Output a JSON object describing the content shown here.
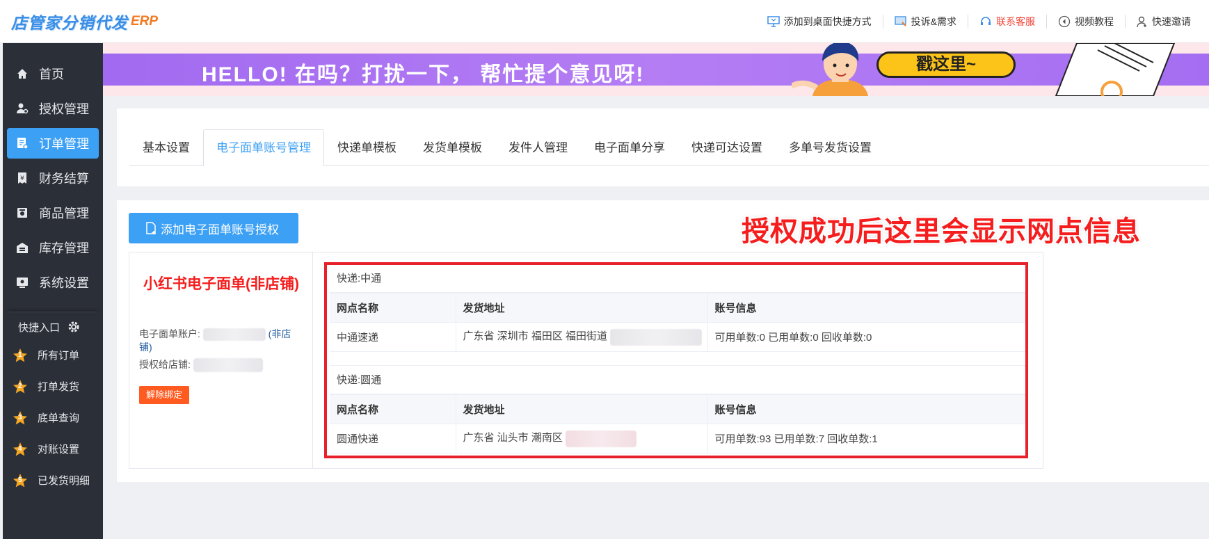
{
  "app": {
    "logo_text": "店管家分销代发",
    "logo_suffix": "ERP"
  },
  "topnav": [
    {
      "label": "添加到桌面快捷方式",
      "icon": "desktop-icon"
    },
    {
      "label": "投诉&需求",
      "icon": "feedback-icon"
    },
    {
      "label": "联系客服",
      "icon": "headset-icon",
      "color": "#f04134"
    },
    {
      "label": "视频教程",
      "icon": "play-icon"
    },
    {
      "label": "快速邀请",
      "icon": "user-add-icon"
    }
  ],
  "sidebar": {
    "items": [
      {
        "label": "首页",
        "icon": "home-icon"
      },
      {
        "label": "授权管理",
        "icon": "user-key-icon"
      },
      {
        "label": "订单管理",
        "icon": "order-icon",
        "active": true
      },
      {
        "label": "财务结算",
        "icon": "finance-icon"
      },
      {
        "label": "商品管理",
        "icon": "goods-icon"
      },
      {
        "label": "库存管理",
        "icon": "warehouse-icon"
      },
      {
        "label": "系统设置",
        "icon": "settings-icon"
      }
    ],
    "quick_title": "快捷入口",
    "quick_items": [
      {
        "label": "所有订单",
        "num": "1"
      },
      {
        "label": "打单发货",
        "num": "2"
      },
      {
        "label": "底单查询",
        "num": "3"
      },
      {
        "label": "对账设置",
        "num": "4"
      },
      {
        "label": "已发货明细",
        "num": "5"
      }
    ]
  },
  "banner": {
    "text": "HELLO! 在吗？打扰一下，  帮忙提个意见呀!",
    "button": "戳这里~"
  },
  "tabs": [
    {
      "label": "基本设置"
    },
    {
      "label": "电子面单账号管理",
      "active": true
    },
    {
      "label": "快递单模板"
    },
    {
      "label": "发货单模板"
    },
    {
      "label": "发件人管理"
    },
    {
      "label": "电子面单分享"
    },
    {
      "label": "快递可达设置"
    },
    {
      "label": "多单号发货设置"
    }
  ],
  "main": {
    "add_button": "添加电子面单账号授权",
    "annotation": "授权成功后这里会显示网点信息",
    "account": {
      "title": "小红书电子面单(非店铺)",
      "account_label": "电子面单账户:",
      "account_tag": "(非店铺)",
      "shop_label": "授权给店铺:",
      "unbind_button": "解除绑定"
    },
    "columns": [
      "网点名称",
      "发货地址",
      "账号信息"
    ],
    "carriers": [
      {
        "title": "快递:中通",
        "rows": [
          {
            "name": "中通速递",
            "address": "广东省 深圳市 福田区 福田街道",
            "info": "可用单数:0 已用单数:0 回收单数:0"
          }
        ]
      },
      {
        "title": "快递:圆通",
        "rows": [
          {
            "name": "圆通快递",
            "address": "广东省 汕头市 潮南区",
            "info": "可用单数:93 已用单数:7 回收单数:1"
          }
        ]
      }
    ]
  }
}
